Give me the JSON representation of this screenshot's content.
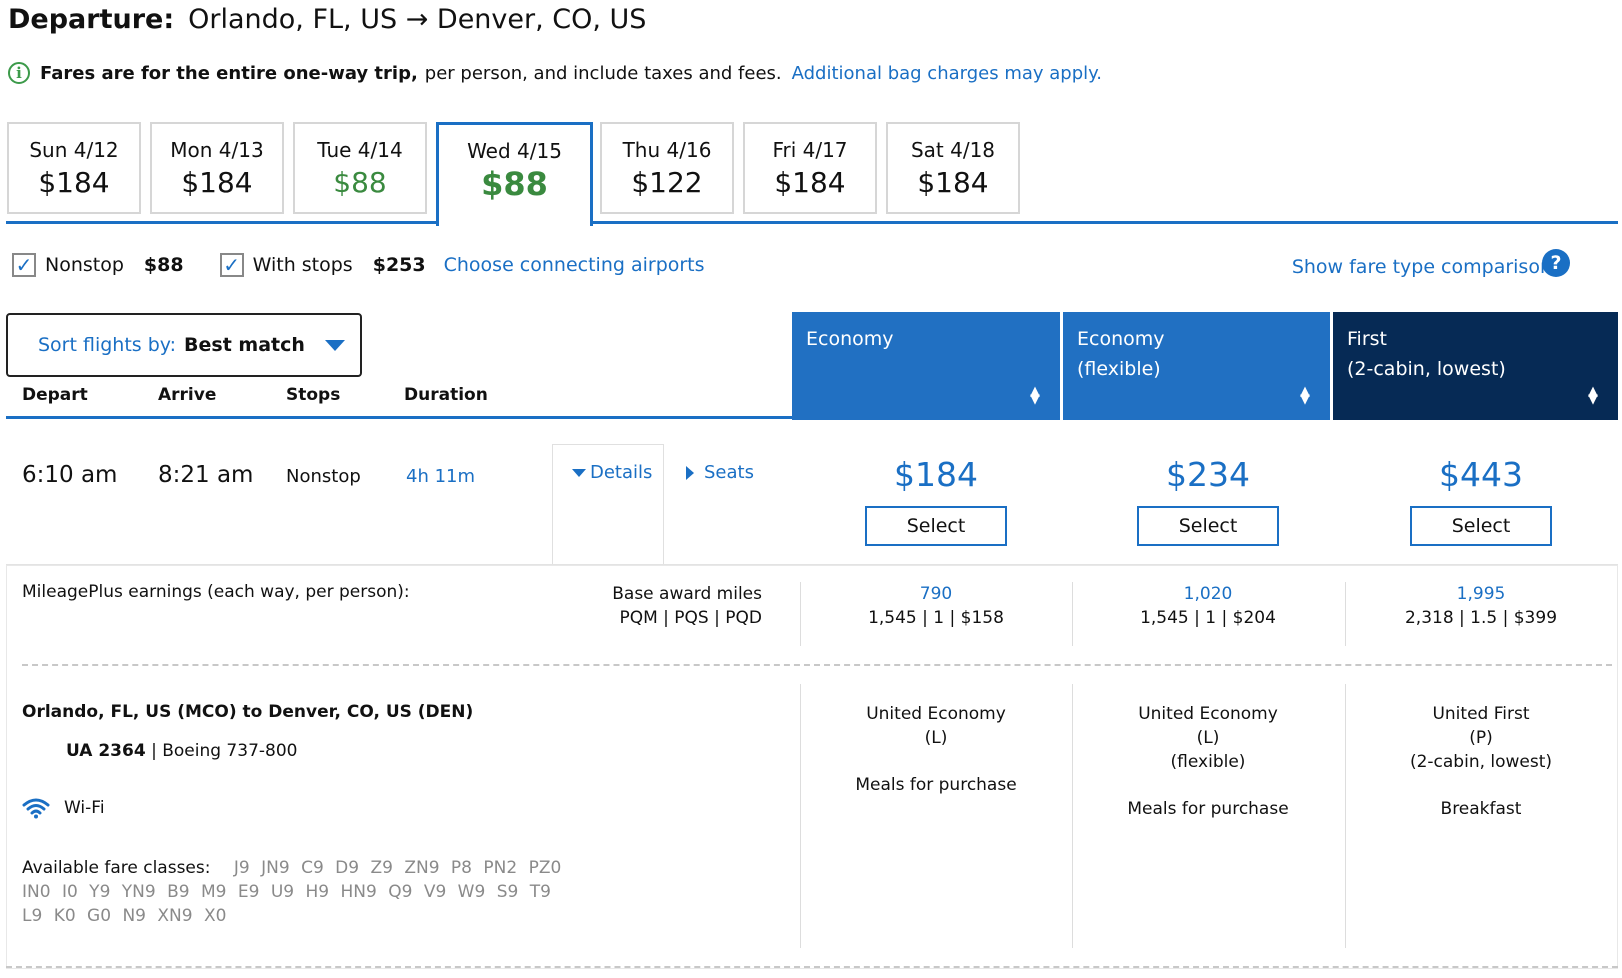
{
  "header": {
    "label": "Departure:",
    "route": "Orlando, FL, US → Denver, CO, US"
  },
  "notice": {
    "bold": "Fares are for the entire one-way trip,",
    "text": "per person, and include taxes and fees.",
    "link": "Additional bag charges may apply."
  },
  "dates": [
    {
      "day": "Sun 4/12",
      "price": "$184"
    },
    {
      "day": "Mon 4/13",
      "price": "$184"
    },
    {
      "day": "Tue 4/14",
      "price": "$88"
    },
    {
      "day": "Wed 4/15",
      "price": "$88"
    },
    {
      "day": "Thu 4/16",
      "price": "$122"
    },
    {
      "day": "Fri 4/17",
      "price": "$184"
    },
    {
      "day": "Sat 4/18",
      "price": "$184"
    }
  ],
  "filters": {
    "nonstop_label": "Nonstop",
    "nonstop_price": "$88",
    "stops_label": "With stops",
    "stops_price": "$253",
    "connecting_link": "Choose connecting airports",
    "compare_link": "Show fare type comparison",
    "help": "?"
  },
  "sort": {
    "label": "Sort flights by:",
    "value": "Best match"
  },
  "columns": {
    "depart": "Depart",
    "arrive": "Arrive",
    "stops": "Stops",
    "duration": "Duration"
  },
  "fare_headers": [
    {
      "line1": "Economy",
      "line2": ""
    },
    {
      "line1": "Economy",
      "line2": "(flexible)"
    },
    {
      "line1": "First",
      "line2": "(2-cabin, lowest)"
    }
  ],
  "flight": {
    "depart": "6:10 am",
    "arrive": "8:21 am",
    "stops": "Nonstop",
    "duration": "4h 11m",
    "details_link": "Details",
    "seats_link": "Seats",
    "fares": [
      {
        "price": "$184",
        "button": "Select"
      },
      {
        "price": "$234",
        "button": "Select"
      },
      {
        "price": "$443",
        "button": "Select"
      }
    ]
  },
  "mileage": {
    "label": "MileagePlus earnings (each way, per person):",
    "base_label": "Base award miles",
    "pq_label": "PQM | PQS | PQD",
    "cols": [
      {
        "miles": "790",
        "pq": "1,545 | 1 | $158"
      },
      {
        "miles": "1,020",
        "pq": "1,545 | 1 | $204"
      },
      {
        "miles": "1,995",
        "pq": "2,318 | 1.5 | $399"
      }
    ]
  },
  "segment": {
    "route": "Orlando, FL, US (MCO) to Denver, CO, US (DEN)",
    "flight_no": "UA 2364",
    "aircraft": "Boeing 737-800",
    "wifi": "Wi-Fi",
    "fare_classes_label": "Available fare classes:",
    "fare_classes": "J9  JN9  C9  D9  Z9  ZN9  P8  PN2  PZ0  IN0  I0  Y9  YN9  B9  M9  E9  U9  H9  HN9  Q9  V9  W9  S9  T9  L9  K0  G0  N9  XN9  X0"
  },
  "cabins": [
    {
      "l1": "United Economy",
      "l2": "(L)",
      "l3": "",
      "meal": "Meals for purchase"
    },
    {
      "l1": "United Economy",
      "l2": "(L)",
      "l3": "(flexible)",
      "meal": "Meals for purchase"
    },
    {
      "l1": "United First",
      "l2": "(P)",
      "l3": "(2-cabin, lowest)",
      "meal": "Breakfast"
    }
  ],
  "colors": {
    "accent": "#1a6fc4",
    "green": "#3a8a3f",
    "first_header": "#062a55"
  }
}
